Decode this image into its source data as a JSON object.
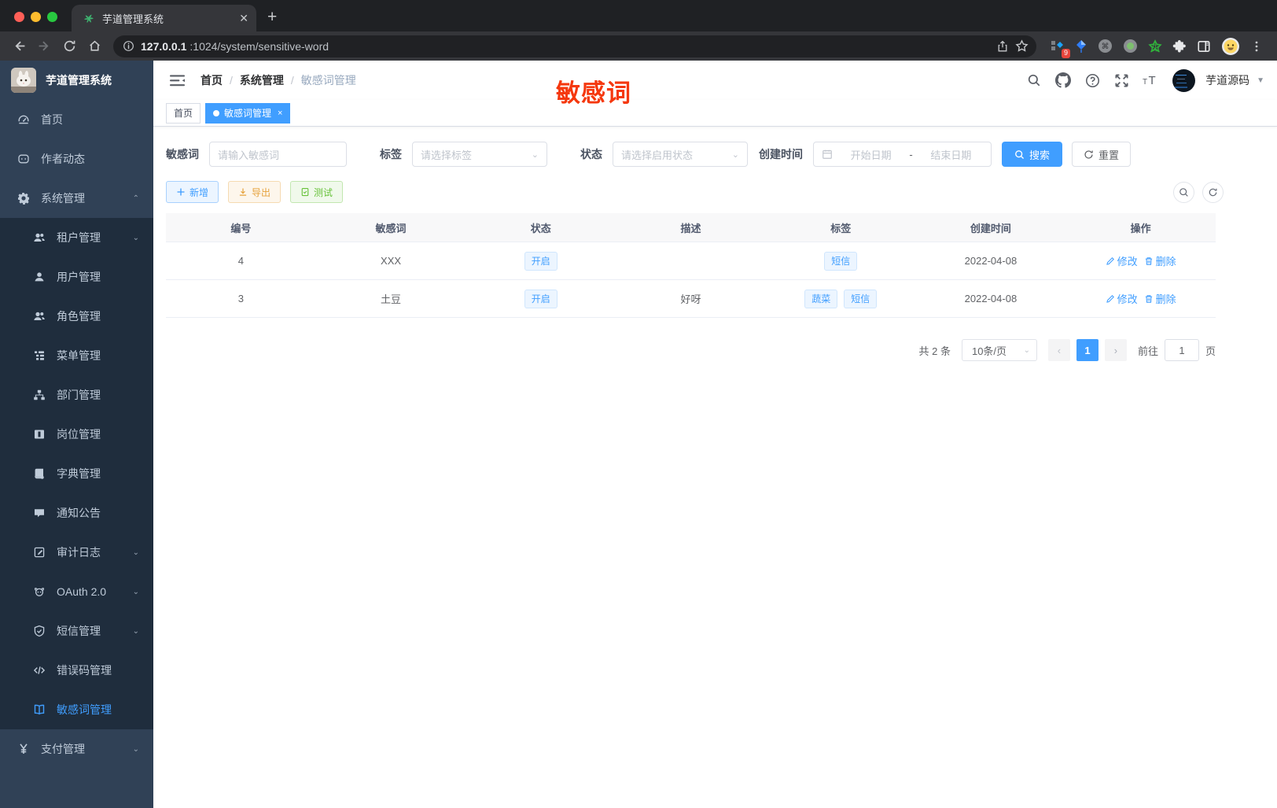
{
  "browser": {
    "tab_title": "芋道管理系统",
    "url_host": "127.0.0.1",
    "url_path": ":1024/system/sensitive-word",
    "extension_badge": "9"
  },
  "sidebar": {
    "app_title": "芋道管理系统",
    "items": [
      {
        "label": "首页",
        "icon": "dashboard-icon",
        "level": 1,
        "active": false,
        "arrow": ""
      },
      {
        "label": "作者动态",
        "icon": "author-message-icon",
        "level": 1,
        "active": false,
        "arrow": ""
      },
      {
        "label": "系统管理",
        "icon": "gear-icon",
        "level": 1,
        "active": false,
        "arrow": "up"
      },
      {
        "label": "租户管理",
        "icon": "tenant-users-icon",
        "level": 2,
        "active": false,
        "arrow": "down"
      },
      {
        "label": "用户管理",
        "icon": "user-icon",
        "level": 2,
        "active": false,
        "arrow": ""
      },
      {
        "label": "角色管理",
        "icon": "role-users-icon",
        "level": 2,
        "active": false,
        "arrow": ""
      },
      {
        "label": "菜单管理",
        "icon": "menu-tree-icon",
        "level": 2,
        "active": false,
        "arrow": ""
      },
      {
        "label": "部门管理",
        "icon": "org-chart-icon",
        "level": 2,
        "active": false,
        "arrow": ""
      },
      {
        "label": "岗位管理",
        "icon": "post-badge-icon",
        "level": 2,
        "active": false,
        "arrow": ""
      },
      {
        "label": "字典管理",
        "icon": "dict-book-icon",
        "level": 2,
        "active": false,
        "arrow": ""
      },
      {
        "label": "通知公告",
        "icon": "notice-comment-icon",
        "level": 2,
        "active": false,
        "arrow": ""
      },
      {
        "label": "审计日志",
        "icon": "audit-log-icon",
        "level": 2,
        "active": false,
        "arrow": "down"
      },
      {
        "label": "OAuth 2.0",
        "icon": "oauth-icon",
        "level": 2,
        "active": false,
        "arrow": "down"
      },
      {
        "label": "短信管理",
        "icon": "sms-shield-icon",
        "level": 2,
        "active": false,
        "arrow": "down"
      },
      {
        "label": "错误码管理",
        "icon": "error-code-icon",
        "level": 2,
        "active": false,
        "arrow": ""
      },
      {
        "label": "敏感词管理",
        "icon": "sensitive-word-book-icon",
        "level": 2,
        "active": true,
        "arrow": ""
      },
      {
        "label": "支付管理",
        "icon": "pay-yen-icon",
        "level": 1,
        "active": false,
        "arrow": "down"
      }
    ]
  },
  "navbar": {
    "breadcrumb": [
      "首页",
      "系统管理",
      "敏感词管理"
    ],
    "username": "芋道源码"
  },
  "annotation": {
    "text": "敏感词",
    "color": "#f5380e"
  },
  "tags_view": [
    {
      "label": "首页",
      "active": false,
      "closable": false
    },
    {
      "label": "敏感词管理",
      "active": true,
      "closable": true
    }
  ],
  "filters": {
    "keyword_label": "敏感词",
    "keyword_placeholder": "请输入敏感词",
    "tag_label": "标签",
    "tag_placeholder": "请选择标签",
    "status_label": "状态",
    "status_placeholder": "请选择启用状态",
    "date_label": "创建时间",
    "date_start_placeholder": "开始日期",
    "date_separator": "-",
    "date_end_placeholder": "结束日期",
    "search_label": "搜索",
    "reset_label": "重置"
  },
  "actions": {
    "add_label": "新增",
    "export_label": "导出",
    "test_label": "测试"
  },
  "table": {
    "columns": [
      "编号",
      "敏感词",
      "状态",
      "描述",
      "标签",
      "创建时间",
      "操作"
    ],
    "rows": [
      {
        "id": "4",
        "word": "XXX",
        "status": "开启",
        "description": "",
        "tags": [
          "短信"
        ],
        "created": "2022-04-08"
      },
      {
        "id": "3",
        "word": "土豆",
        "status": "开启",
        "description": "好呀",
        "tags": [
          "蔬菜",
          "短信"
        ],
        "created": "2022-04-08"
      }
    ],
    "edit_label": "修改",
    "delete_label": "删除"
  },
  "pagination": {
    "total_text": "共 2 条",
    "page_size": "10条/页",
    "current_page": "1",
    "goto_label": "前往",
    "goto_value": "1",
    "page_unit": "页"
  },
  "colors": {
    "accent": "#409eff",
    "sidebar_bg": "#304156",
    "submenu_bg": "#1f2d3d",
    "warning": "#e6a23c",
    "success": "#67c23a",
    "annotation_red": "#f5380e"
  }
}
